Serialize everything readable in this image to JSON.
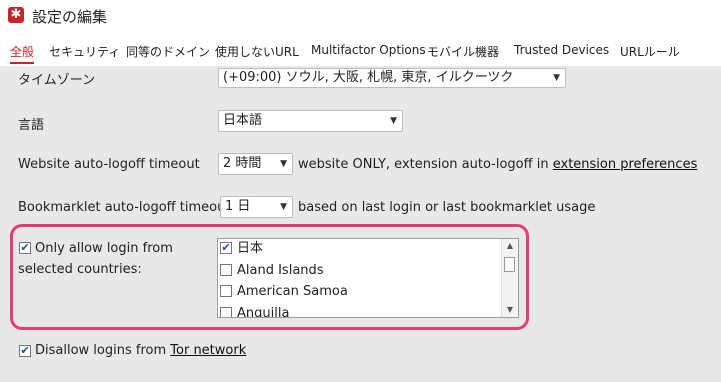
{
  "window": {
    "title": "設定の編集"
  },
  "tabs": [
    {
      "label": "全般"
    },
    {
      "label": "セキュリティ"
    },
    {
      "label": "同等のドメイン"
    },
    {
      "label": "使用しないURL"
    },
    {
      "label": "Multifactor Options"
    },
    {
      "label": "モバイル機器"
    },
    {
      "label": "Trusted Devices"
    },
    {
      "label": "URLルール"
    }
  ],
  "settings": {
    "timezone": {
      "label": "タイムゾーン",
      "value": "(+09:00) ソウル, 大阪, 札幌, 東京, イルクーツク"
    },
    "language": {
      "label": "言語",
      "value": "日本語"
    },
    "website_logoff": {
      "label": "Website auto-logoff timeout",
      "value": "2 時間",
      "note": "website ONLY, extension auto-logoff in",
      "link": "extension preferences"
    },
    "bookmarklet_logoff": {
      "label": "Bookmarklet auto-logoff timeout",
      "value": "1 日",
      "note": "based on last login or last bookmarklet usage"
    },
    "country_restriction": {
      "label_line1": "Only allow login from",
      "label_line2": "selected countries:",
      "checked": true,
      "countries": [
        {
          "name": "日本",
          "checked": true
        },
        {
          "name": "Aland Islands",
          "checked": false
        },
        {
          "name": "American Samoa",
          "checked": false
        },
        {
          "name": "Anguilla",
          "checked": false
        }
      ]
    },
    "tor": {
      "label": "Disallow logins from",
      "link": "Tor network",
      "checked": true
    }
  },
  "colors": {
    "accent": "#c8242b",
    "highlight": "#e83a73",
    "background": "#e8e8e8"
  }
}
